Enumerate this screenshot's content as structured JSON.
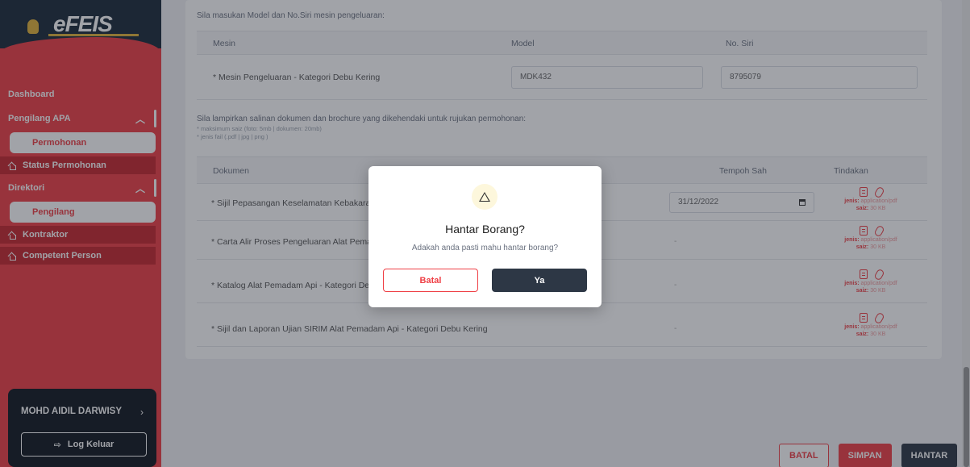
{
  "brand": {
    "logo_text": "eFEIS"
  },
  "sidebar": {
    "dashboard": "Dashboard",
    "pengilang_apa": "Pengilang APA",
    "permohonan": "Permohonan",
    "status_permohonan": "Status Permohonan",
    "direktori": "Direktori",
    "pengilang": "Pengilang",
    "kontraktor": "Kontraktor",
    "competent_person": "Competent Person",
    "user_name": "MOHD AIDIL DARWISY",
    "logout": "Log Keluar"
  },
  "machine_section": {
    "intro": "Sila masukan Model dan No.Siri mesin pengeluaran:",
    "headers": {
      "mesin": "Mesin",
      "model": "Model",
      "no_siri": "No. Siri"
    },
    "row": {
      "label": "* Mesin Pengeluaran - Kategori Debu Kering",
      "model": "MDK432",
      "no_siri": "8795079"
    }
  },
  "documents_section": {
    "intro": "Sila lampirkan salinan dokumen dan brochure yang dikehendaki untuk rujukan permohonan:",
    "note1": "* maksimum saiz (foto: 5mb | dokumen: 20mb)",
    "note2": "* jenis fail (.pdf | jpg | png )",
    "headers": {
      "dokumen": "Dokumen",
      "tempoh_sah": "Tempoh Sah",
      "tindakan": "Tindakan"
    },
    "rows": [
      {
        "name": "* Sijil Pepasangan Keselamatan Kebakaran",
        "tempoh": "31/12/2022"
      },
      {
        "name": "* Carta Alir Proses Pengeluaran Alat Pemadam Api",
        "tempoh": "-"
      },
      {
        "name": "* Katalog Alat Pemadam Api - Kategori Debu Kering",
        "tempoh": "-"
      },
      {
        "name": "* Sijil dan Laporan Ujian SIRIM Alat Pemadam Api - Kategori Debu Kering",
        "tempoh": "-"
      }
    ],
    "meta": {
      "jenis_label": "jenis:",
      "jenis_value": "application/pdf",
      "saiz_label": "saiz:",
      "saiz_value": "30 KB"
    }
  },
  "footer_buttons": {
    "batal": "BATAL",
    "simpan": "SIMPAN",
    "hantar": "HANTAR"
  },
  "modal": {
    "title": "Hantar Borang?",
    "message": "Adakah anda pasti mahu hantar borang?",
    "cancel": "Batal",
    "confirm": "Ya"
  },
  "colors": {
    "accent": "#ef3f45",
    "dark": "#2d3745",
    "brand_bg": "#1b2a3a"
  }
}
